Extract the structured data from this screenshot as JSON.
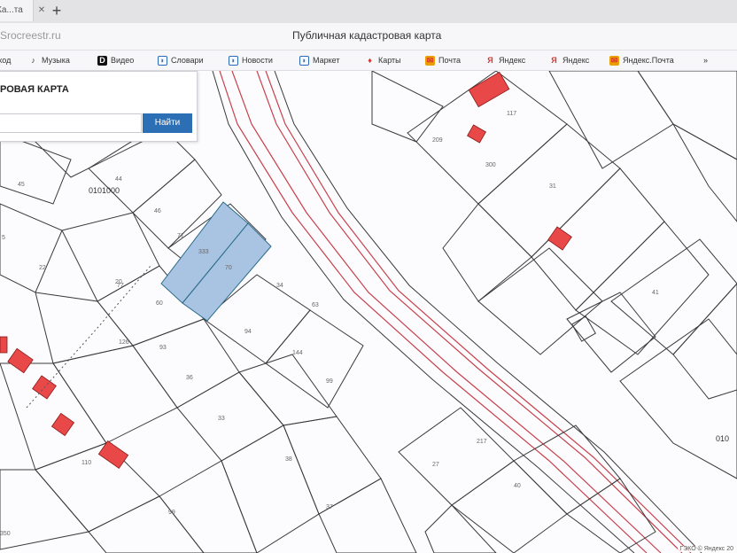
{
  "browser": {
    "tab_title": "Ка...та",
    "tab_close": "✕",
    "new_tab": "+",
    "url": "Sroсreestr.ru",
    "page_title": "Публичная кадастровая карта"
  },
  "bookmarks": [
    {
      "label": "Вход",
      "icon": "folder-icon",
      "color": "#7a7a7a"
    },
    {
      "label": "Музыка",
      "icon": "music-icon",
      "color": "#333333"
    },
    {
      "label": "Видео",
      "icon": "video-icon",
      "color": "#111111"
    },
    {
      "label": "Словари",
      "icon": "dictionary-icon",
      "color": "#2a6ab8"
    },
    {
      "label": "Новости",
      "icon": "news-icon",
      "color": "#2a6ab8"
    },
    {
      "label": "Маркет",
      "icon": "market-icon",
      "color": "#2a6ab8"
    },
    {
      "label": "Карты",
      "icon": "maps-icon",
      "color": "#d33"
    },
    {
      "label": "Почта",
      "icon": "mail-icon",
      "color": "#e8a000"
    },
    {
      "label": "Яндекс",
      "icon": "yandex-icon",
      "color": "#d33"
    },
    {
      "label": "Яндекс",
      "icon": "yandex-icon",
      "color": "#d33"
    },
    {
      "label": "Яндекс.Почта",
      "icon": "mail-icon",
      "color": "#e8a000"
    },
    {
      "label": "»",
      "icon": "more-icon",
      "color": "#444444"
    }
  ],
  "search_panel": {
    "title": "РОВАЯ КАРТА",
    "input_value": "",
    "button_label": "Найти"
  },
  "map": {
    "quarter_labels": [
      "0101000",
      "010"
    ],
    "parcel_labels": [
      "44",
      "46",
      "71",
      "333",
      "70",
      "34",
      "63",
      "94",
      "144",
      "99",
      "60",
      "77",
      "93",
      "36",
      "33",
      "38",
      "37",
      "99",
      "20",
      "22",
      "45",
      "5",
      "31",
      "41",
      "40",
      "350",
      "117",
      "209",
      "110",
      "126",
      "300",
      "217",
      "27"
    ],
    "copyright": "ГЭКО © Яндекс 20"
  },
  "colors": {
    "boundary": "#3a3a3a",
    "road_line": "#c8414b",
    "selected_fill": "#a9c4e2",
    "building_fill": "#e84848",
    "search_button": "#2d6fb5"
  }
}
